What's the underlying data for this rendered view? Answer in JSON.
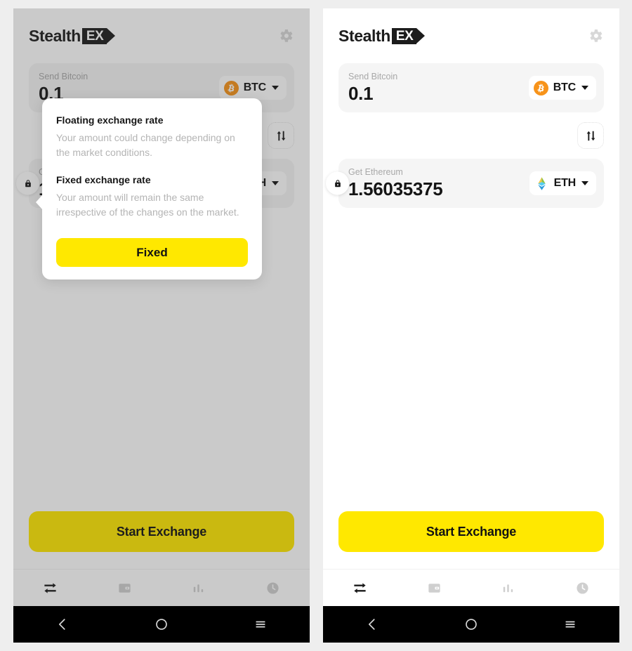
{
  "app": {
    "logo_word": "Stealth",
    "logo_badge": "EX",
    "settings_icon": "gear-icon"
  },
  "exchange": {
    "send": {
      "label": "Send Bitcoin",
      "amount": "0.1",
      "coin_symbol": "BTC",
      "coin_icon": "bitcoin-icon"
    },
    "swap_icon": "swap-vertical-icon",
    "get": {
      "label": "Get Ethereum",
      "amount": "1.56035375",
      "coin_symbol": "ETH",
      "coin_icon": "ethereum-icon",
      "lock_icon": "lock-closed-icon"
    },
    "cta_label": "Start Exchange"
  },
  "popover": {
    "floating_title": "Floating exchange rate",
    "floating_text": "Your amount could change depending on the market conditions.",
    "fixed_title": "Fixed exchange rate",
    "fixed_text": "Your amount will remain the same irrespective of the changes on the market.",
    "button_label": "Fixed"
  },
  "tabbar": {
    "items": [
      {
        "name": "exchange",
        "icon": "swap-horizontal-icon",
        "active": true
      },
      {
        "name": "wallet",
        "icon": "wallet-icon",
        "active": false
      },
      {
        "name": "rates",
        "icon": "bar-chart-icon",
        "active": false
      },
      {
        "name": "history",
        "icon": "clock-icon",
        "active": false
      }
    ]
  },
  "system_nav": {
    "back_icon": "chevron-back-icon",
    "home_icon": "circle-home-icon",
    "recents_icon": "menu-recents-icon"
  },
  "colors": {
    "accent_yellow": "#ffe800",
    "bitcoin_orange": "#f7931a",
    "page_background": "#eeeeee",
    "field_background": "#f5f5f5"
  }
}
